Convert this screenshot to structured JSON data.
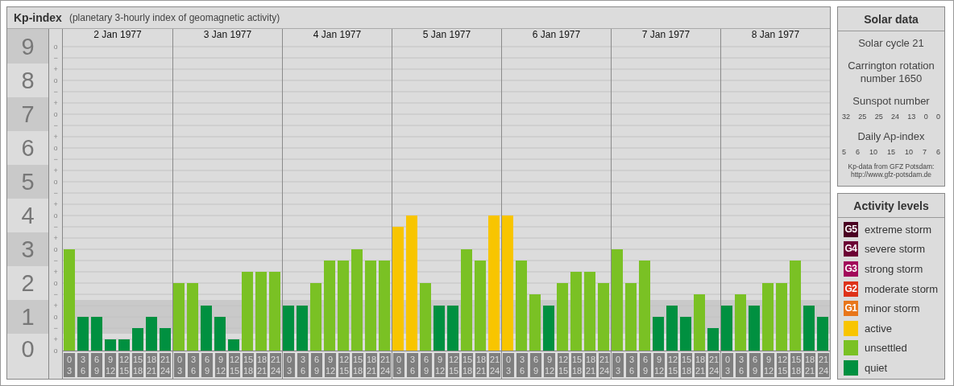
{
  "main": {
    "title": "Kp-index",
    "subtitle": "(planetary 3-hourly index of geomagnetic activity)",
    "y_marks": [
      "o",
      "−",
      "+",
      "o",
      "−",
      "+",
      "o",
      "−",
      "+",
      "o",
      "−",
      "+",
      "o",
      "−",
      "+",
      "o",
      "−",
      "+",
      "o",
      "−",
      "+",
      "o",
      "−",
      "+",
      "o",
      "−",
      "+",
      "o"
    ],
    "days": [
      "2 Jan 1977",
      "3 Jan 1977",
      "4 Jan 1977",
      "5 Jan 1977",
      "6 Jan 1977",
      "7 Jan 1977",
      "8 Jan 1977"
    ],
    "chart_data": {
      "type": "bar",
      "grid": true,
      "ylim": [
        0,
        9.1667
      ],
      "yticks": [
        {
          "value": 0,
          "label": "0"
        },
        {
          "value": 1,
          "label": "1"
        },
        {
          "value": 2,
          "label": "2"
        },
        {
          "value": 3,
          "label": "3"
        },
        {
          "value": 4,
          "label": "4"
        },
        {
          "value": 5,
          "label": "5"
        },
        {
          "value": 6,
          "label": "6"
        },
        {
          "value": 7,
          "label": "7"
        },
        {
          "value": 8,
          "label": "8"
        },
        {
          "value": 9,
          "label": "9"
        }
      ],
      "categories": [
        "0 3",
        "3 6",
        "6 9",
        "9 12",
        "12 15",
        "15 18",
        "18 21",
        "21 24",
        "0 3",
        "3 6",
        "6 9",
        "9 12",
        "12 15",
        "15 18",
        "18 21",
        "21 24",
        "0 3",
        "3 6",
        "6 9",
        "9 12",
        "12 15",
        "15 18",
        "18 21",
        "21 24",
        "0 3",
        "3 6",
        "6 9",
        "9 12",
        "12 15",
        "15 18",
        "18 21",
        "21 24",
        "0 3",
        "3 6",
        "6 9",
        "9 12",
        "12 15",
        "15 18",
        "18 21",
        "21 24",
        "0 3",
        "3 6",
        "6 9",
        "9 12",
        "12 15",
        "15 18",
        "18 21",
        "21 24",
        "0 3",
        "3 6",
        "6 9",
        "9 12",
        "12 15",
        "15 18",
        "18 21",
        "21 24"
      ],
      "series": [
        {
          "name": "active",
          "color": "#f8c500",
          "values": [
            null,
            null,
            null,
            null,
            null,
            null,
            null,
            null,
            null,
            null,
            null,
            null,
            null,
            null,
            null,
            null,
            null,
            null,
            null,
            null,
            null,
            null,
            null,
            null,
            3.67,
            4,
            null,
            null,
            null,
            null,
            null,
            4,
            4,
            null,
            null,
            null,
            null,
            null,
            null,
            null,
            null,
            null,
            null,
            null,
            null,
            null,
            null,
            null,
            null,
            null,
            null,
            null,
            null,
            null,
            null,
            null
          ]
        },
        {
          "name": "unsettled",
          "color": "#7ac124",
          "values": [
            3,
            null,
            null,
            null,
            null,
            null,
            null,
            null,
            2,
            2,
            null,
            null,
            null,
            2.33,
            2.33,
            2.33,
            null,
            null,
            2,
            2.67,
            2.67,
            3,
            2.67,
            2.67,
            null,
            null,
            2,
            null,
            null,
            3,
            2.67,
            null,
            null,
            2.67,
            1.67,
            null,
            2,
            2.33,
            2.33,
            2,
            3,
            2,
            2.67,
            null,
            null,
            null,
            1.67,
            null,
            null,
            1.67,
            null,
            2,
            2,
            2.67,
            null,
            null
          ]
        },
        {
          "name": "quiet",
          "color": "#009040",
          "values": [
            null,
            1,
            1,
            0.33,
            0.33,
            0.67,
            1,
            0.67,
            null,
            null,
            1.33,
            1,
            0.33,
            null,
            null,
            null,
            1.33,
            1.33,
            null,
            null,
            null,
            null,
            null,
            null,
            null,
            null,
            null,
            1.33,
            1.33,
            null,
            null,
            null,
            null,
            null,
            null,
            1.33,
            null,
            null,
            null,
            null,
            null,
            null,
            null,
            1,
            1.33,
            1,
            null,
            0.67,
            1.33,
            null,
            1.33,
            null,
            null,
            null,
            1.33,
            1
          ]
        }
      ]
    }
  },
  "solar": {
    "title": "Solar data",
    "cycle": "Solar cycle 21",
    "rotation": [
      "Carrington rotation",
      "number 1650"
    ],
    "sunspot_title": "Sunspot number",
    "sunspots": [
      "32",
      "25",
      "25",
      "24",
      "13",
      "0",
      "0"
    ],
    "ap_title": "Daily Ap-index",
    "ap": [
      "5",
      "6",
      "10",
      "15",
      "10",
      "7",
      "6"
    ],
    "credit": [
      "Kp-data from GFZ Potsdam:",
      "http://www.gfz-potsdam.de"
    ]
  },
  "legend": {
    "title": "Activity levels",
    "items": [
      {
        "badge": "G5",
        "label": "extreme storm",
        "color": "#4a0022"
      },
      {
        "badge": "G4",
        "label": "severe storm",
        "color": "#6c0034"
      },
      {
        "badge": "G3",
        "label": "strong storm",
        "color": "#a2085a"
      },
      {
        "badge": "G2",
        "label": "moderate storm",
        "color": "#de3219"
      },
      {
        "badge": "G1",
        "label": "minor storm",
        "color": "#e8761a"
      }
    ]
  }
}
